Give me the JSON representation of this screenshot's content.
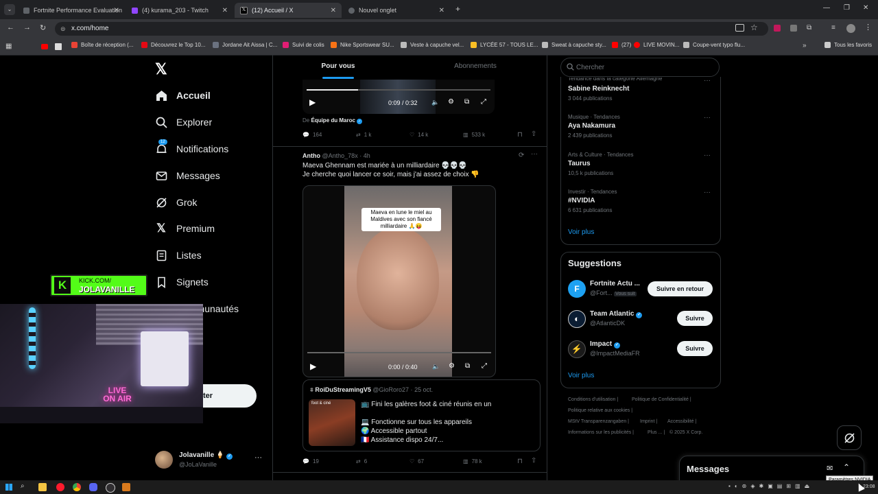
{
  "browser": {
    "tabs": [
      {
        "label": "Fortnite Performance Evaluation",
        "color": "#5f6368"
      },
      {
        "label": "(4) kurama_203 - Twitch",
        "color": "#9146ff"
      },
      {
        "label": "(12) Accueil / X",
        "color": "#000000"
      },
      {
        "label": "Nouvel onglet",
        "color": "#5f6368"
      }
    ],
    "url": "x.com/home",
    "bookmarks": [
      {
        "label": "Boîte de réception (...",
        "color": "#ea4335"
      },
      {
        "label": "Découvrez le Top 10...",
        "color": "#e50914"
      },
      {
        "label": "Jordane Ait Aissa | C...",
        "color": "#6b7280"
      },
      {
        "label": "Suivi de colis",
        "color": "#e11d74"
      },
      {
        "label": "Nike Sportswear SU...",
        "color": "#f97316"
      },
      {
        "label": "Veste à capuche vel...",
        "color": "#bbbbbb"
      },
      {
        "label": "LYCÉE 57 - TOUS LE...",
        "color": "#fbbf24"
      },
      {
        "label": "Sweat à capuche sty...",
        "color": "#bbbbbb"
      },
      {
        "label": "(27)",
        "color": "#ff0000"
      },
      {
        "label": "LIVE MOVIN...",
        "color": "#ff0000"
      },
      {
        "label": "Coupe-vent typo flu...",
        "color": "#bbbbbb"
      }
    ],
    "all_bookmarks": "Tous les favoris"
  },
  "nav": {
    "items": [
      {
        "label": "Accueil",
        "icon": "home-icon"
      },
      {
        "label": "Explorer",
        "icon": "search-icon"
      },
      {
        "label": "Notifications",
        "icon": "bell-icon",
        "badge": "12"
      },
      {
        "label": "Messages",
        "icon": "mail-icon"
      },
      {
        "label": "Grok",
        "icon": "grok-icon"
      },
      {
        "label": "Premium",
        "icon": "x-icon"
      },
      {
        "label": "Listes",
        "icon": "list-icon"
      },
      {
        "label": "Signets",
        "icon": "bookmark-icon"
      },
      {
        "label": "Communautés",
        "icon": "community-icon"
      }
    ],
    "post_button_fragment": "ster",
    "profile": {
      "name": "Jolavanille",
      "handle": "@JoLaVanille",
      "emoji": "🍦"
    }
  },
  "overlay": {
    "kick_line1": "KICK.COM/",
    "kick_line2": "JOLAVANILLE",
    "live_sign": "LIVE ON AIR"
  },
  "feed": {
    "tabs": [
      "Pour vous",
      "Abonnements"
    ],
    "video1": {
      "time": "0:09 / 0:32",
      "from_prefix": "De",
      "from": "Équipe du Maroc"
    },
    "tweet1_stats": {
      "replies": "164",
      "reposts": "1 k",
      "likes": "14 k",
      "views": "533 k"
    },
    "tweet2": {
      "name": "Antho",
      "handle": "@Antho_78x",
      "time": "4h",
      "line1": "Maeva Ghennam est mariée à un milliardaire 💀💀💀",
      "line2": "Je cherche quoi lancer ce soir, mais j'ai assez de choix 👎",
      "caption": "Maeva en lune le miel au Maldives avec son fiancé milliardaire 🙏😝",
      "video_time": "0:00 / 0:40"
    },
    "quote": {
      "name": "RoiDuStreamingV5",
      "handle": "@GioRoro27",
      "date": "25 oct.",
      "thumb_label": "foot & ciné",
      "lines": [
        "📺 Fini les galères foot & ciné réunis en un",
        "💻 Fonctionne sur tous les appareils",
        "🌍 Accessible partout",
        "🇫🇷 Assistance dispo 24/7..."
      ]
    },
    "tweet2_stats": {
      "replies": "19",
      "reposts": "6",
      "likes": "67",
      "views": "78 k"
    }
  },
  "right": {
    "search_placeholder": "Chercher",
    "trends": [
      {
        "category": "Tendance dans la catégorie Allemagne",
        "name": "Sabine Reinknecht",
        "count": "3 044 publications"
      },
      {
        "category": "Musique · Tendances",
        "name": "Aya Nakamura",
        "count": "2 439 publications"
      },
      {
        "category": "Arts & Culture · Tendances",
        "name": "Taurus",
        "count": "10,5 k publications"
      },
      {
        "category": "Investir · Tendances",
        "name": "#NVIDIA",
        "count": "6 631 publications"
      }
    ],
    "trends_more": "Voir plus",
    "suggestions_title": "Suggestions",
    "suggestions": [
      {
        "name": "Fortnite Actu ...",
        "handle": "@Fort...",
        "follows_you": "Vous suit",
        "button": "Suivre en retour",
        "avatar_color": "#1da1f2",
        "avatar_letter": "F"
      },
      {
        "name": "Team Atlantic",
        "handle": "@AtlanticDK",
        "button": "Suivre",
        "avatar_color": "#0b1d33",
        "avatar_letter": "◐"
      },
      {
        "name": "Impact",
        "handle": "@ImpactMediaFR",
        "button": "Suivre",
        "avatar_color": "#1a1a1a",
        "avatar_letter": "⚡"
      }
    ],
    "suggestions_more": "Voir plus",
    "footer": [
      "Conditions d'utilisation",
      "Politique de Confidentialité",
      "Politique relative aux cookies",
      "MStV Transparenzangaben",
      "Imprint",
      "Accessibilité",
      "Informations sur les publicités",
      "Plus ...",
      "© 2025 X Corp."
    ],
    "messages_drawer": "Messages"
  },
  "taskbar": {
    "tooltip": "Paramètres NVIDIA",
    "clock": "23:08"
  },
  "colors": {
    "accent": "#1d9bf0",
    "kick_green": "#53fc18",
    "bg": "#000000",
    "border": "#2f3336"
  }
}
